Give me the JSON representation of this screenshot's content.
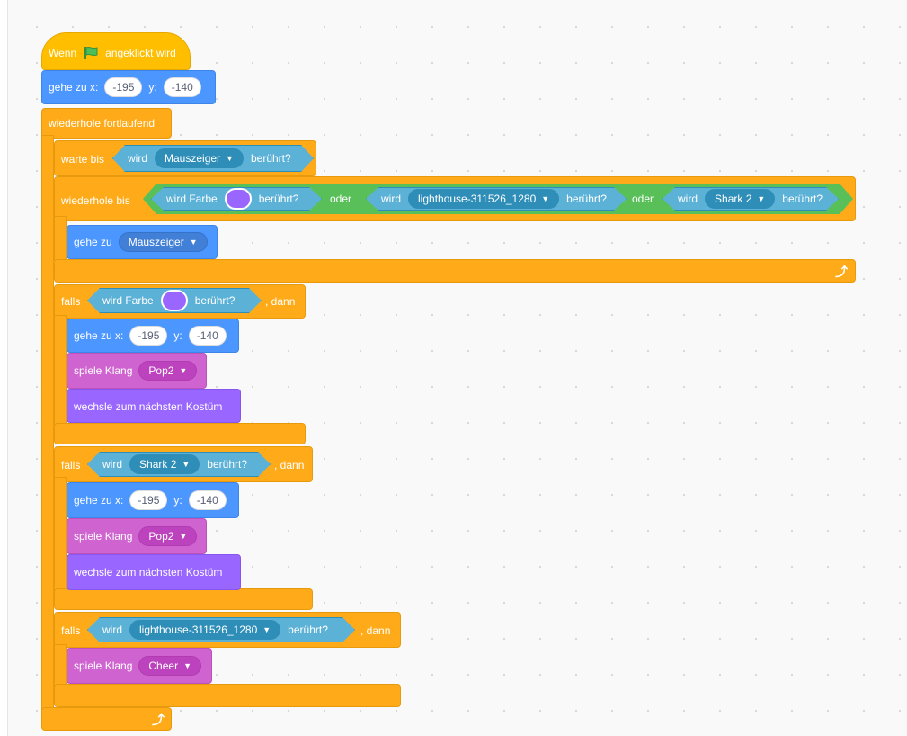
{
  "colors": {
    "event": "#ffbf00",
    "control": "#ffab19",
    "motion": "#4c97ff",
    "sound": "#cf63cf",
    "looks": "#9966ff",
    "sensing": "#5cb1d6",
    "operators": "#59c059",
    "swatch": "#9966ff"
  },
  "hat": {
    "before": "Wenn",
    "icon": "green-flag-icon",
    "after": "angeklickt wird"
  },
  "goto_start": {
    "label": "gehe zu x:",
    "x": "-195",
    "ylabel": "y:",
    "y": "-140"
  },
  "forever": {
    "label": "wiederhole fortlaufend",
    "loop_icon": "loop-arrow-icon"
  },
  "wait_until": {
    "label": "warte bis",
    "wird": "wird",
    "menu": "Mauszeiger",
    "touched": "berührt?"
  },
  "repeat_until": {
    "label": "wiederhole bis",
    "cond1": {
      "wird": "wird Farbe",
      "touched": "berührt?"
    },
    "or1": "oder",
    "cond2": {
      "wird": "wird",
      "menu": "lighthouse-311526_1280",
      "touched": "berührt?"
    },
    "or2": "oder",
    "cond3": {
      "wird": "wird",
      "menu": "Shark 2",
      "touched": "berührt?"
    },
    "inner": {
      "label": "gehe zu",
      "menu": "Mauszeiger"
    }
  },
  "if1": {
    "label": "falls",
    "cond_wird": "wird Farbe",
    "cond_touched": "berührt?",
    "then": ", dann",
    "goto": {
      "label": "gehe zu x:",
      "x": "-195",
      "ylabel": "y:",
      "y": "-140"
    },
    "sound": {
      "label": "spiele Klang",
      "menu": "Pop2"
    },
    "costume": "wechsle zum nächsten Kostüm"
  },
  "if2": {
    "label": "falls",
    "cond_wird": "wird",
    "cond_menu": "Shark 2",
    "cond_touched": "berührt?",
    "then": ", dann",
    "goto": {
      "label": "gehe zu x:",
      "x": "-195",
      "ylabel": "y:",
      "y": "-140"
    },
    "sound": {
      "label": "spiele Klang",
      "menu": "Pop2"
    },
    "costume": "wechsle zum nächsten Kostüm"
  },
  "if3": {
    "label": "falls",
    "cond_wird": "wird",
    "cond_menu": "lighthouse-311526_1280",
    "cond_touched": "berührt?",
    "then": ", dann",
    "sound": {
      "label": "spiele Klang",
      "menu": "Cheer"
    }
  }
}
